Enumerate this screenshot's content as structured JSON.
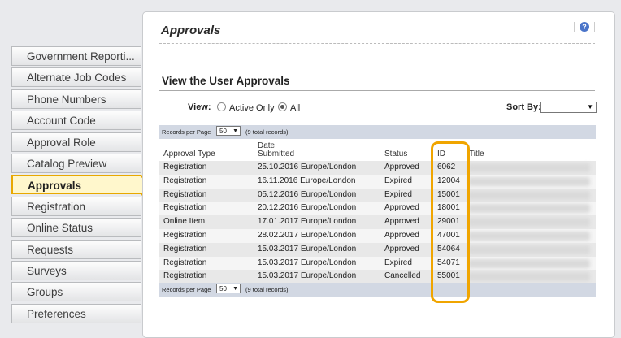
{
  "sidebar": {
    "items": [
      {
        "label": "Government Reporti..."
      },
      {
        "label": "Alternate Job Codes"
      },
      {
        "label": "Phone Numbers"
      },
      {
        "label": "Account Code"
      },
      {
        "label": "Approval Role"
      },
      {
        "label": "Catalog Preview"
      },
      {
        "label": "Approvals",
        "active": true
      },
      {
        "label": "Registration"
      },
      {
        "label": "Online Status"
      },
      {
        "label": "Requests"
      },
      {
        "label": "Surveys"
      },
      {
        "label": "Groups"
      },
      {
        "label": "Preferences"
      }
    ]
  },
  "page": {
    "title": "Approvals",
    "help_icon": "?",
    "section_title": "View the User Approvals"
  },
  "view": {
    "label": "View:",
    "options": [
      {
        "label": "Active Only",
        "checked": false
      },
      {
        "label": "All",
        "checked": true
      }
    ]
  },
  "sort_by": {
    "label": "Sort By:",
    "value": ""
  },
  "pager": {
    "label": "Records per Page",
    "page_size": "50",
    "total": "(9 total records)"
  },
  "table": {
    "columns": [
      "Approval Type",
      "Date Submitted",
      "Status",
      "ID",
      "Title"
    ],
    "date_header_line1": "Date",
    "date_header_line2": "Submitted",
    "rows": [
      {
        "type": "Registration",
        "date": "25.10.2016 Europe/London",
        "status": "Approved",
        "id": "6062"
      },
      {
        "type": "Registration",
        "date": "16.11.2016 Europe/London",
        "status": "Expired",
        "id": "12004"
      },
      {
        "type": "Registration",
        "date": "05.12.2016 Europe/London",
        "status": "Expired",
        "id": "15001"
      },
      {
        "type": "Registration",
        "date": "20.12.2016 Europe/London",
        "status": "Approved",
        "id": "18001"
      },
      {
        "type": "Online Item",
        "date": "17.01.2017 Europe/London",
        "status": "Approved",
        "id": "29001"
      },
      {
        "type": "Registration",
        "date": "28.02.2017 Europe/London",
        "status": "Approved",
        "id": "47001"
      },
      {
        "type": "Registration",
        "date": "15.03.2017 Europe/London",
        "status": "Approved",
        "id": "54064"
      },
      {
        "type": "Registration",
        "date": "15.03.2017 Europe/London",
        "status": "Expired",
        "id": "54071"
      },
      {
        "type": "Registration",
        "date": "15.03.2017 Europe/London",
        "status": "Cancelled",
        "id": "55001"
      }
    ]
  },
  "colors": {
    "highlight": "#f0a500",
    "active_item_bg": "#fff7cc",
    "pager_bg": "#d2d8e3"
  }
}
